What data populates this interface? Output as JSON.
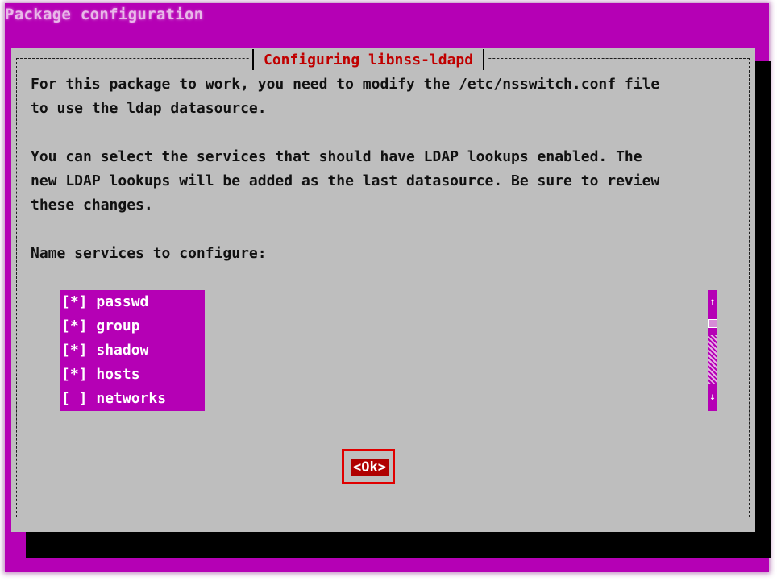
{
  "screen": {
    "title": "Package configuration"
  },
  "dialog": {
    "title": "Configuring libnss-ldapd",
    "paragraph1": "For this package to work, you need to modify the /etc/nsswitch.conf file\nto use the ldap datasource.",
    "paragraph2": "You can select the services that should have LDAP lookups enabled. The\nnew LDAP lookups will be added as the last datasource. Be sure to review\nthese changes.",
    "services_label": "Name services to configure:",
    "services": [
      {
        "check": "[*]",
        "name": "passwd"
      },
      {
        "check": "[*]",
        "name": "group"
      },
      {
        "check": "[*]",
        "name": "shadow"
      },
      {
        "check": "[*]",
        "name": "hosts"
      },
      {
        "check": "[ ]",
        "name": "networks"
      }
    ],
    "scrollbar": {
      "up": "↑",
      "down": "↓"
    },
    "ok_label": "<Ok>"
  },
  "colors": {
    "background": "#b500b5",
    "dialog": "#bebebe",
    "title": "#c00000",
    "ok_button": "#b00000",
    "focus_ring": "#e00000"
  }
}
